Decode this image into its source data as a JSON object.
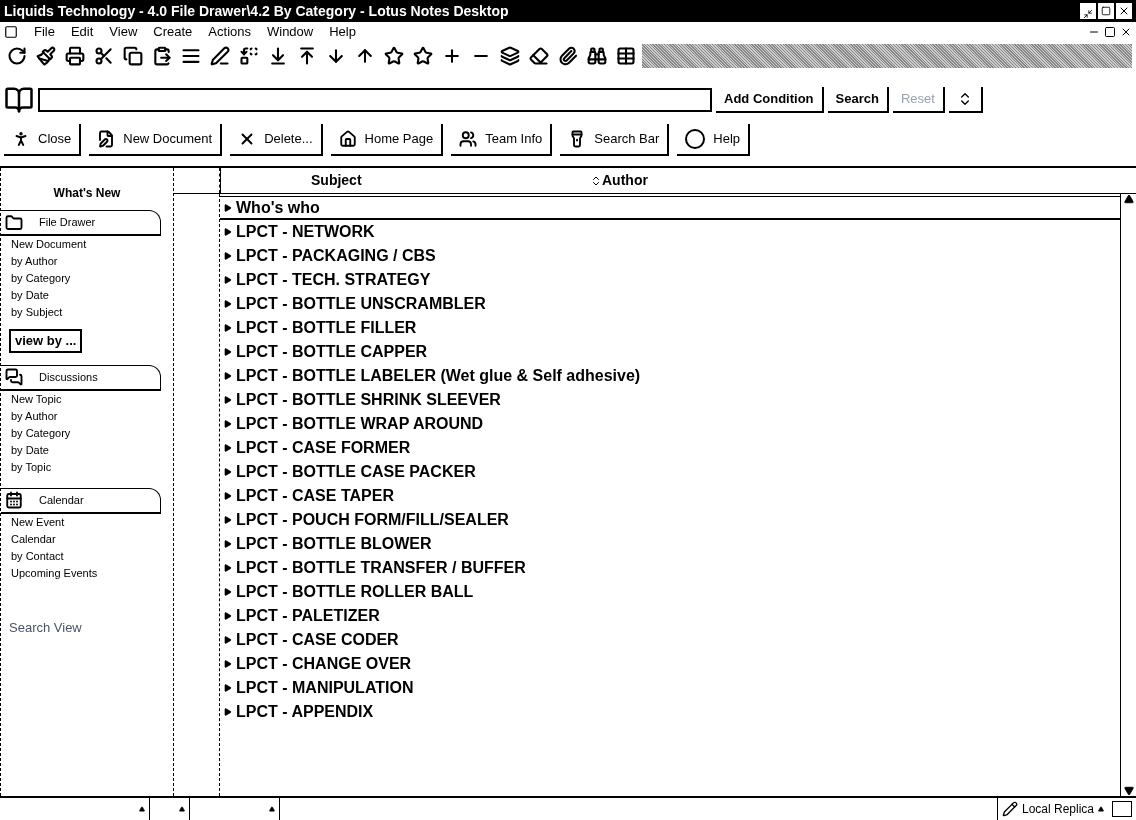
{
  "window": {
    "title": "Liquids Technology - 4.0 File Drawer\\4.2 By Category - Lotus Notes Desktop"
  },
  "menu": [
    "File",
    "Edit",
    "View",
    "Create",
    "Actions",
    "Window",
    "Help"
  ],
  "search_bar": {
    "buttons": [
      {
        "label": "Add Condition",
        "disabled": false
      },
      {
        "label": "Search",
        "disabled": false
      },
      {
        "label": "Reset",
        "disabled": true
      }
    ]
  },
  "action_bar": [
    "Close",
    "New Document",
    "Delete...",
    "Home Page",
    "Team Info",
    "Search Bar",
    "Help"
  ],
  "navigator": {
    "whats_new": "What's New",
    "sections": [
      {
        "kind": "drawer",
        "title": "File Drawer",
        "items": [
          "New Document",
          "by Author",
          "by Category",
          "by Date",
          "by Subject"
        ],
        "button": "view by ..."
      },
      {
        "kind": "discussion",
        "title": "Discussions",
        "items": [
          "New Topic",
          "by Author",
          "by Category",
          "by Date",
          "by Topic"
        ]
      },
      {
        "kind": "calendar",
        "title": "Calendar",
        "items": [
          "New Event",
          "Calendar",
          "by Contact",
          "Upcoming Events"
        ]
      }
    ],
    "search_view": "Search View"
  },
  "view": {
    "columns": [
      "Subject",
      "Author"
    ],
    "rows": [
      {
        "label": "Who's who",
        "selected": true
      },
      {
        "label": "LPCT - NETWORK",
        "selected": false
      },
      {
        "label": "LPCT - PACKAGING / CBS",
        "selected": false
      },
      {
        "label": "LPCT - TECH. STRATEGY",
        "selected": false
      },
      {
        "label": "LPCT - BOTTLE UNSCRAMBLER",
        "selected": false
      },
      {
        "label": "LPCT - BOTTLE FILLER",
        "selected": false
      },
      {
        "label": "LPCT - BOTTLE CAPPER",
        "selected": false
      },
      {
        "label": "LPCT - BOTTLE LABELER (Wet glue & Self adhesive)",
        "selected": false
      },
      {
        "label": "LPCT - BOTTLE SHRINK SLEEVER",
        "selected": false
      },
      {
        "label": "LPCT - BOTTLE WRAP AROUND",
        "selected": false
      },
      {
        "label": "LPCT - CASE FORMER",
        "selected": false
      },
      {
        "label": "LPCT - BOTTLE CASE PACKER",
        "selected": false
      },
      {
        "label": "LPCT - CASE TAPER",
        "selected": false
      },
      {
        "label": "LPCT - POUCH FORM/FILL/SEALER",
        "selected": false
      },
      {
        "label": "LPCT - BOTTLE BLOWER",
        "selected": false
      },
      {
        "label": "LPCT - BOTTLE TRANSFER / BUFFER",
        "selected": false
      },
      {
        "label": "LPCT - BOTTLE ROLLER BALL",
        "selected": false
      },
      {
        "label": "LPCT - PALETIZER",
        "selected": false
      },
      {
        "label": "LPCT - CASE CODER",
        "selected": false
      },
      {
        "label": "LPCT - CHANGE OVER",
        "selected": false
      },
      {
        "label": "LPCT - MANIPULATION",
        "selected": false
      },
      {
        "label": "LPCT - APPENDIX",
        "selected": false
      }
    ]
  },
  "status_bar": {
    "location": "Local Replica"
  }
}
